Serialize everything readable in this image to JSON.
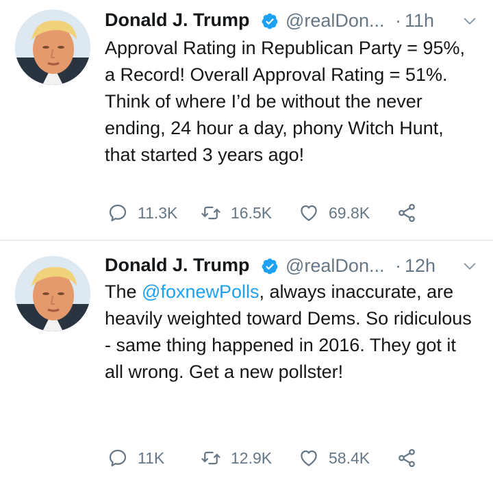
{
  "tweets": [
    {
      "author_name": "Donald J. Trump",
      "handle": "@realDon...",
      "separator": "·",
      "time": "11h",
      "text": "Approval Rating in Republican Party = 95%, a Record! Overall Approval Rating = 51%. Think of where I’d be without the never ending, 24 hour a day, phony Witch Hunt, that started 3 years ago!",
      "replies": "11.3K",
      "retweets": "16.5K",
      "likes": "69.8K"
    },
    {
      "author_name": "Donald J. Trump",
      "handle": "@realDon...",
      "separator": "·",
      "time": "12h",
      "text_before": "The ",
      "mention": "@foxnewPolls",
      "text_after": ", always inaccurate, are heavily weighted toward Dems. So ridiculous - same thing happened in 2016. They got it all wrong. Get a new pollster!",
      "replies": "11K",
      "retweets": "12.9K",
      "likes": "58.4K"
    }
  ],
  "icons": {
    "verified": "verified-badge-icon",
    "caret": "chevron-down-icon",
    "reply": "reply-icon",
    "retweet": "retweet-icon",
    "like": "heart-icon",
    "share": "share-icon"
  },
  "colors": {
    "text": "#14171a",
    "secondary": "#657786",
    "link": "#1da1f2",
    "verified": "#1da1f2",
    "divider": "#e6ecf0"
  }
}
